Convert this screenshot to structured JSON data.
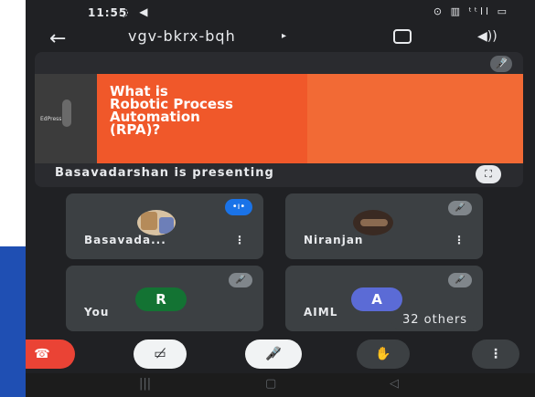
{
  "status_bar": {
    "time": "11:55",
    "status_icons": "◌ ◀",
    "right_icons": "⊙ ▥ ᵗᵗll ▭"
  },
  "top_bar": {
    "meeting_code": "vgv-bkrx-bqh",
    "caret": "▸"
  },
  "presentation": {
    "slide_title": "What is\nRobotic Process\nAutomation\n(RPA)?",
    "slide_side_label": "EdPress",
    "slide_subtitle": "",
    "slide_body": "",
    "presenter_text": "Basavadarshan is presenting"
  },
  "participants": [
    {
      "name": "Basavada...",
      "status": "speaking"
    },
    {
      "name": "Niranjan",
      "status": "muted"
    },
    {
      "name": "You",
      "avatar_letter": "R",
      "avatar_color": "#137333",
      "status": "muted"
    },
    {
      "name": "AIML",
      "avatar_letter": "A",
      "avatar_color": "#5b6bd6",
      "status": "muted"
    }
  ],
  "others_label": "32 others",
  "controls": {
    "end_call": "end-call",
    "camera": "camera-off",
    "microphone": "mic-off",
    "raise_hand": "raise-hand",
    "more": "more-options"
  },
  "colors": {
    "end_call": "#ea4335",
    "speaking_badge": "#1a73e8",
    "slide_accent": "#f0582a"
  }
}
